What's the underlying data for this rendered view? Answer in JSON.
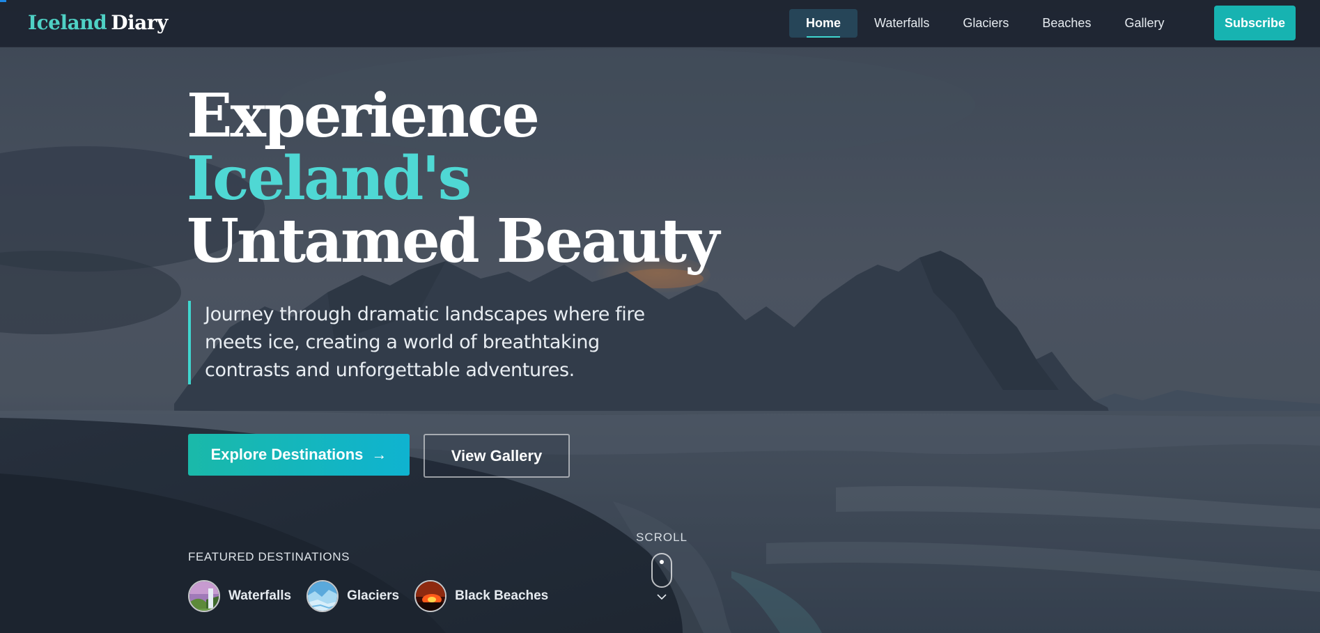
{
  "brand": {
    "name_part1": "Iceland",
    "name_part2": "Diary"
  },
  "nav": {
    "items": [
      {
        "label": "Home",
        "active": true
      },
      {
        "label": "Waterfalls",
        "active": false
      },
      {
        "label": "Glaciers",
        "active": false
      },
      {
        "label": "Beaches",
        "active": false
      },
      {
        "label": "Gallery",
        "active": false
      }
    ],
    "subscribe_label": "Subscribe"
  },
  "hero": {
    "headline_line1": "Experience",
    "headline_line2": "Iceland's",
    "headline_line3": "Untamed Beauty",
    "intro": "Journey through dramatic landscapes where fire meets ice, creating a world of breathtaking contrasts and unforgettable adventures.",
    "primary_button": "Explore Destinations",
    "primary_button_arrow": "→",
    "secondary_button": "View Gallery",
    "featured_label": "FEATURED DESTINATIONS",
    "destinations": [
      {
        "name": "Waterfalls",
        "icon": "waterfall-thumb"
      },
      {
        "name": "Glaciers",
        "icon": "glacier-thumb"
      },
      {
        "name": "Black Beaches",
        "icon": "lava-thumb"
      }
    ],
    "scroll_label": "SCROLL"
  },
  "colors": {
    "accent": "#4fd8d4",
    "button": "#17b3b1",
    "nav_bg": "#1c2430"
  }
}
